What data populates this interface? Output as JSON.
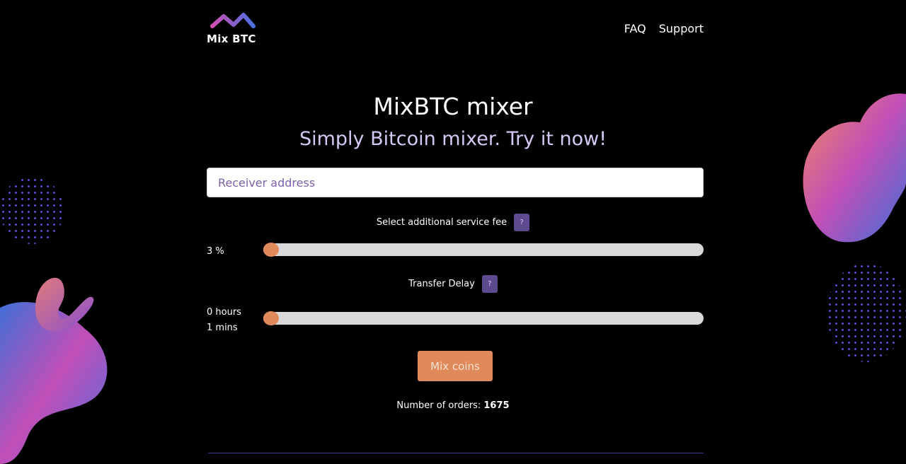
{
  "header": {
    "logo_text": "Mix BTC",
    "nav": [
      {
        "label": "FAQ"
      },
      {
        "label": "Support"
      }
    ]
  },
  "hero": {
    "title": "MixBTC mixer",
    "subtitle": "Simply Bitcoin mixer. Try it now!"
  },
  "form": {
    "address_placeholder": "Receiver address",
    "fee": {
      "label": "Select additional service fee",
      "help": "?",
      "value_text": "3 %",
      "level": 0
    },
    "delay": {
      "label": "Transfer Delay",
      "help": "?",
      "value_line1": "0 hours",
      "value_line2": "1 mins",
      "level": 0
    },
    "submit_label": "Mix coins"
  },
  "stats": {
    "orders_label": "Number of orders:",
    "orders_count": "1675"
  },
  "colors": {
    "accent": "#e08a5c",
    "help_bg": "#5e4b8f",
    "subtitle": "#d6c8f5",
    "background": "#000000"
  }
}
